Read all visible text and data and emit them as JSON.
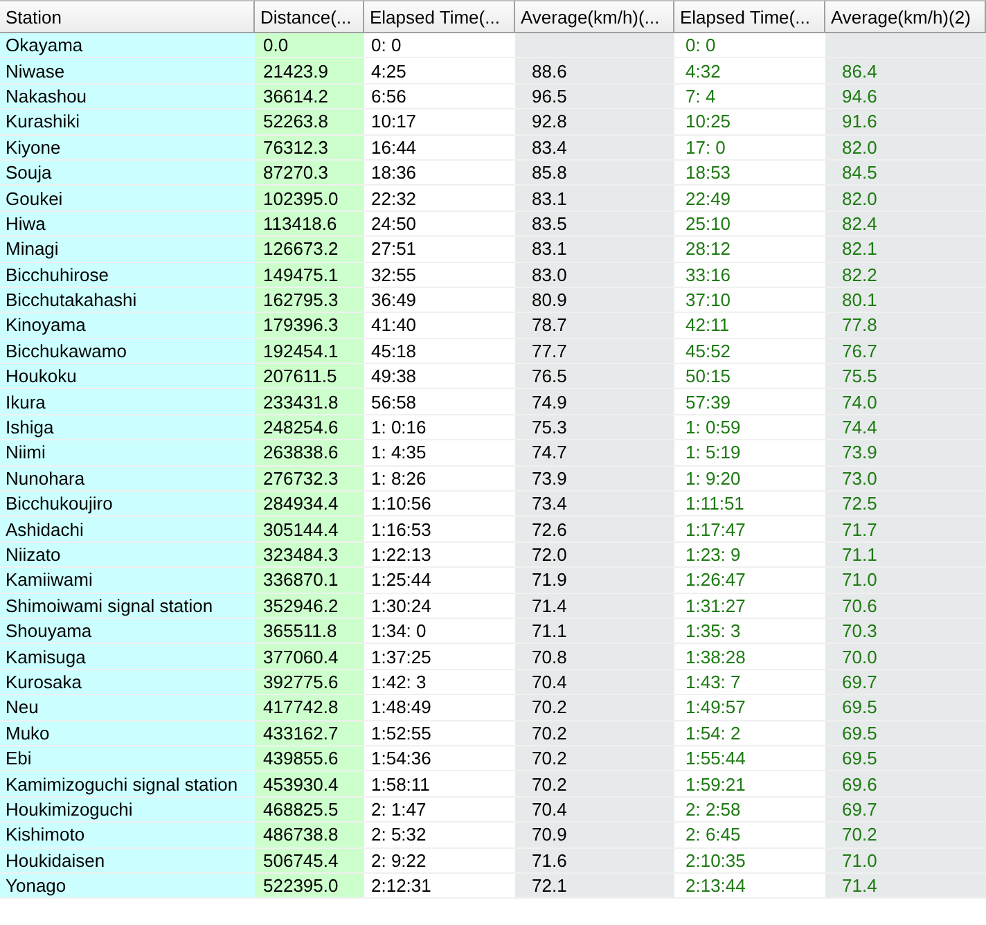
{
  "table": {
    "columns": [
      "Station",
      "Distance(...",
      "Elapsed Time(...",
      "Average(km/h)(...",
      "Elapsed Time(...",
      "Average(km/h)(2)"
    ],
    "rows": [
      {
        "station": "Okayama",
        "distance": "0.0",
        "elapsed_time": "0: 0",
        "elapsed_time_2": "0: 0"
      },
      {
        "station": "Niwase",
        "distance": "21423.9",
        "elapsed_time": "4:25",
        "average": "88.6",
        "elapsed_time_2": "4:32",
        "average_2": "86.4"
      },
      {
        "station": "Nakashou",
        "distance": "36614.2",
        "elapsed_time": "6:56",
        "average": "96.5",
        "elapsed_time_2": "7: 4",
        "average_2": "94.6"
      },
      {
        "station": "Kurashiki",
        "distance": "52263.8",
        "elapsed_time": "10:17",
        "average": "92.8",
        "elapsed_time_2": "10:25",
        "average_2": "91.6"
      },
      {
        "station": "Kiyone",
        "distance": "76312.3",
        "elapsed_time": "16:44",
        "average": "83.4",
        "elapsed_time_2": "17: 0",
        "average_2": "82.0"
      },
      {
        "station": "Souja",
        "distance": "87270.3",
        "elapsed_time": "18:36",
        "average": "85.8",
        "elapsed_time_2": "18:53",
        "average_2": "84.5"
      },
      {
        "station": "Goukei",
        "distance": "102395.0",
        "elapsed_time": "22:32",
        "average": "83.1",
        "elapsed_time_2": "22:49",
        "average_2": "82.0"
      },
      {
        "station": "Hiwa",
        "distance": "113418.6",
        "elapsed_time": "24:50",
        "average": "83.5",
        "elapsed_time_2": "25:10",
        "average_2": "82.4"
      },
      {
        "station": "Minagi",
        "distance": "126673.2",
        "elapsed_time": "27:51",
        "average": "83.1",
        "elapsed_time_2": "28:12",
        "average_2": "82.1"
      },
      {
        "station": "Bicchuhirose",
        "distance": "149475.1",
        "elapsed_time": "32:55",
        "average": "83.0",
        "elapsed_time_2": "33:16",
        "average_2": "82.2"
      },
      {
        "station": "Bicchutakahashi",
        "distance": "162795.3",
        "elapsed_time": "36:49",
        "average": "80.9",
        "elapsed_time_2": "37:10",
        "average_2": "80.1"
      },
      {
        "station": "Kinoyama",
        "distance": "179396.3",
        "elapsed_time": "41:40",
        "average": "78.7",
        "elapsed_time_2": "42:11",
        "average_2": "77.8"
      },
      {
        "station": "Bicchukawamo",
        "distance": "192454.1",
        "elapsed_time": "45:18",
        "average": "77.7",
        "elapsed_time_2": "45:52",
        "average_2": "76.7"
      },
      {
        "station": "Houkoku",
        "distance": "207611.5",
        "elapsed_time": "49:38",
        "average": "76.5",
        "elapsed_time_2": "50:15",
        "average_2": "75.5"
      },
      {
        "station": "Ikura",
        "distance": "233431.8",
        "elapsed_time": "56:58",
        "average": "74.9",
        "elapsed_time_2": "57:39",
        "average_2": "74.0"
      },
      {
        "station": "Ishiga",
        "distance": "248254.6",
        "elapsed_time": "1: 0:16",
        "average": "75.3",
        "elapsed_time_2": "1: 0:59",
        "average_2": "74.4"
      },
      {
        "station": "Niimi",
        "distance": "263838.6",
        "elapsed_time": "1: 4:35",
        "average": "74.7",
        "elapsed_time_2": "1: 5:19",
        "average_2": "73.9"
      },
      {
        "station": "Nunohara",
        "distance": "276732.3",
        "elapsed_time": "1: 8:26",
        "average": "73.9",
        "elapsed_time_2": "1: 9:20",
        "average_2": "73.0"
      },
      {
        "station": "Bicchukoujiro",
        "distance": "284934.4",
        "elapsed_time": "1:10:56",
        "average": "73.4",
        "elapsed_time_2": "1:11:51",
        "average_2": "72.5"
      },
      {
        "station": "Ashidachi",
        "distance": "305144.4",
        "elapsed_time": "1:16:53",
        "average": "72.6",
        "elapsed_time_2": "1:17:47",
        "average_2": "71.7"
      },
      {
        "station": "Niizato",
        "distance": "323484.3",
        "elapsed_time": "1:22:13",
        "average": "72.0",
        "elapsed_time_2": "1:23: 9",
        "average_2": "71.1"
      },
      {
        "station": "Kamiiwami",
        "distance": "336870.1",
        "elapsed_time": "1:25:44",
        "average": "71.9",
        "elapsed_time_2": "1:26:47",
        "average_2": "71.0"
      },
      {
        "station": "Shimoiwami signal station",
        "distance": "352946.2",
        "elapsed_time": "1:30:24",
        "average": "71.4",
        "elapsed_time_2": "1:31:27",
        "average_2": "70.6"
      },
      {
        "station": "Shouyama",
        "distance": "365511.8",
        "elapsed_time": "1:34: 0",
        "average": "71.1",
        "elapsed_time_2": "1:35: 3",
        "average_2": "70.3"
      },
      {
        "station": "Kamisuga",
        "distance": "377060.4",
        "elapsed_time": "1:37:25",
        "average": "70.8",
        "elapsed_time_2": "1:38:28",
        "average_2": "70.0"
      },
      {
        "station": "Kurosaka",
        "distance": "392775.6",
        "elapsed_time": "1:42: 3",
        "average": "70.4",
        "elapsed_time_2": "1:43: 7",
        "average_2": "69.7"
      },
      {
        "station": "Neu",
        "distance": "417742.8",
        "elapsed_time": "1:48:49",
        "average": "70.2",
        "elapsed_time_2": "1:49:57",
        "average_2": "69.5"
      },
      {
        "station": "Muko",
        "distance": "433162.7",
        "elapsed_time": "1:52:55",
        "average": "70.2",
        "elapsed_time_2": "1:54: 2",
        "average_2": "69.5"
      },
      {
        "station": "Ebi",
        "distance": "439855.6",
        "elapsed_time": "1:54:36",
        "average": "70.2",
        "elapsed_time_2": "1:55:44",
        "average_2": "69.5"
      },
      {
        "station": "Kamimizoguchi signal station",
        "distance": "453930.4",
        "elapsed_time": "1:58:11",
        "average": "70.2",
        "elapsed_time_2": "1:59:21",
        "average_2": "69.6"
      },
      {
        "station": "Houkimizoguchi",
        "distance": "468825.5",
        "elapsed_time": "2: 1:47",
        "average": "70.4",
        "elapsed_time_2": "2: 2:58",
        "average_2": "69.7"
      },
      {
        "station": "Kishimoto",
        "distance": "486738.8",
        "elapsed_time": "2: 5:32",
        "average": "70.9",
        "elapsed_time_2": "2: 6:45",
        "average_2": "70.2"
      },
      {
        "station": "Houkidaisen",
        "distance": "506745.4",
        "elapsed_time": "2: 9:22",
        "average": "71.6",
        "elapsed_time_2": "2:10:35",
        "average_2": "71.0"
      },
      {
        "station": "Yonago",
        "distance": "522395.0",
        "elapsed_time": "2:12:31",
        "average": "72.1",
        "elapsed_time_2": "2:13:44",
        "average_2": "71.4"
      }
    ]
  }
}
